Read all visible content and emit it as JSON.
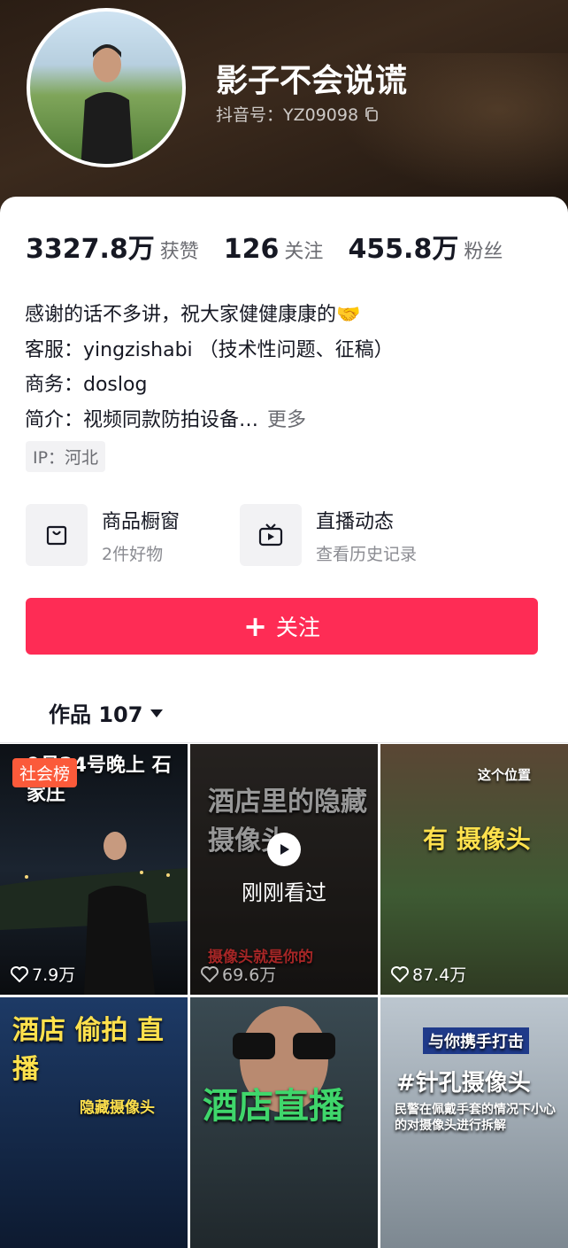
{
  "profile": {
    "username": "影子不会说谎",
    "douyin_id": "抖音号：YZ09098"
  },
  "stats": [
    {
      "value": "3327.8万",
      "label": "获赞"
    },
    {
      "value": "126",
      "label": "关注"
    },
    {
      "value": "455.8万",
      "label": "粉丝"
    }
  ],
  "bio": {
    "line1": "感谢的话不多讲，祝大家健健康康的🤝",
    "line2": "客服：yingzishabi （技术性问题、征稿）",
    "line3": "商务：doslog",
    "line4": "简介：视频同款防拍设备…",
    "more": "更多"
  },
  "ip": "IP：河北",
  "features": [
    {
      "icon": "shopping-bag-icon",
      "title": "商品橱窗",
      "subtitle": "2件好物"
    },
    {
      "icon": "tv-icon",
      "title": "直播动态",
      "subtitle": "查看历史记录"
    }
  ],
  "follow_button": {
    "label": "关注",
    "color": "#fe2c55"
  },
  "works_tab": {
    "label": "作品 107"
  },
  "videos": [
    {
      "badge": "社会榜",
      "caption": "9月24号晚上 石家庄",
      "likes": "7.9万"
    },
    {
      "caption": "酒店里的隐藏摄像头",
      "seen": "刚刚看过",
      "likes": "69.6万",
      "sub": "摄像头就是你的"
    },
    {
      "caption": "有 摄像头",
      "likes": "87.4万",
      "tag": "这个位置"
    },
    {
      "caption": "酒店 偷拍 直播",
      "sub": "隐藏摄像头"
    },
    {
      "caption": "酒店直播"
    },
    {
      "caption": "#针孔摄像头",
      "tag": "与你携手打击",
      "sub": "民警在佩戴手套的情况下小心的对摄像头进行拆解"
    }
  ]
}
